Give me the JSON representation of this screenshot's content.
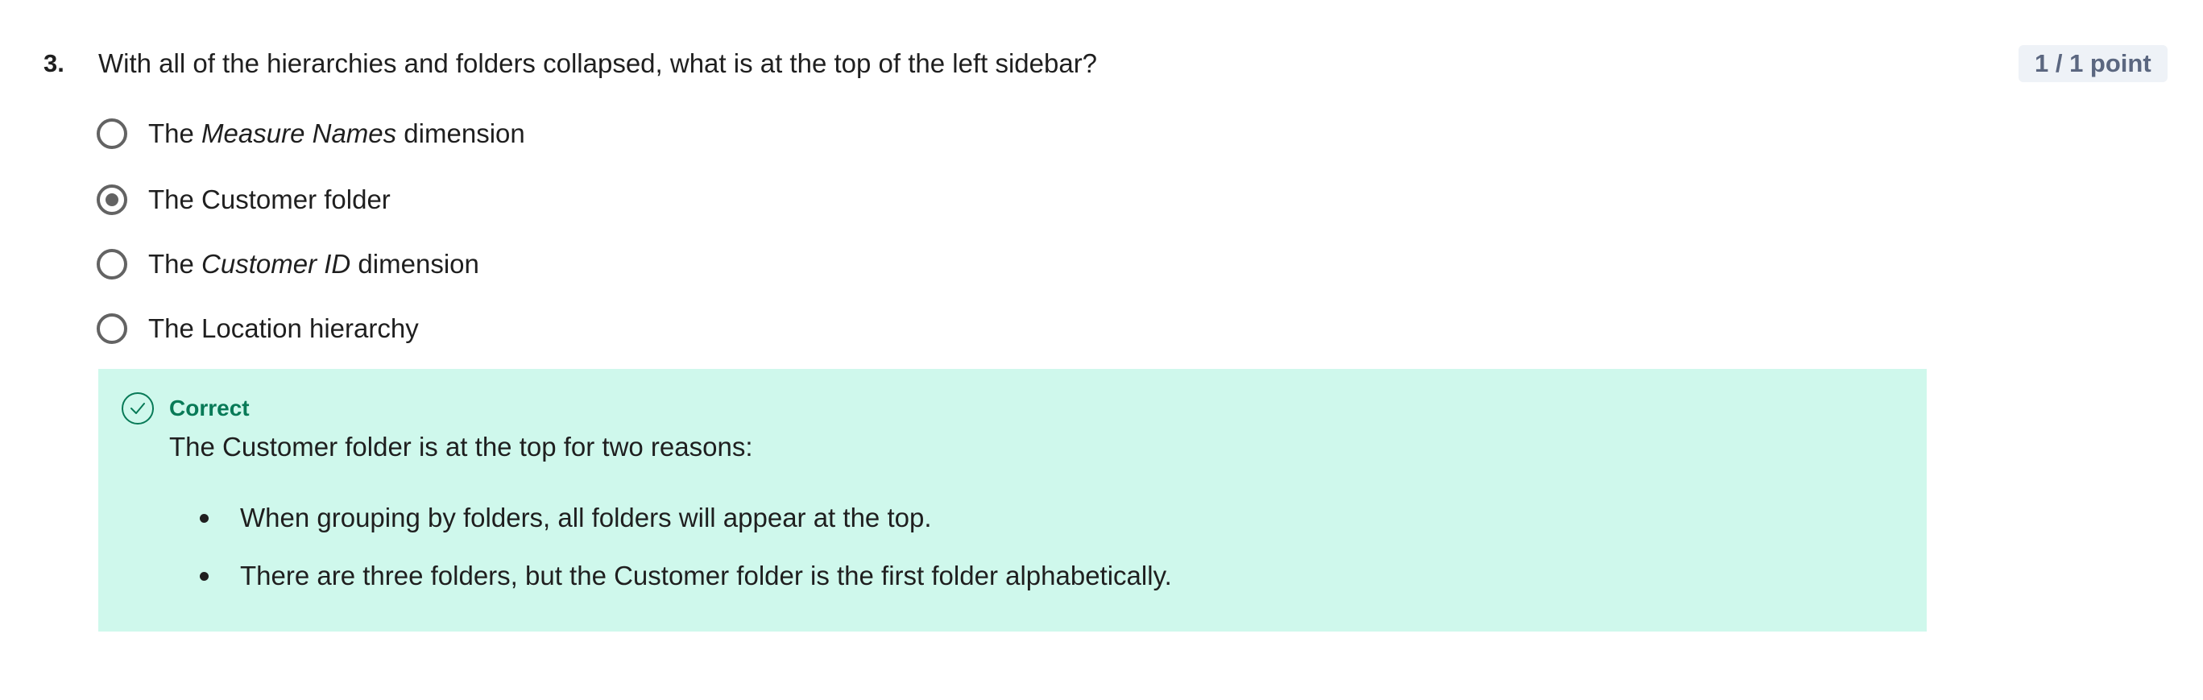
{
  "question": {
    "number": "3.",
    "text": "With all of the hierarchies and folders collapsed, what is at the top of the left sidebar?",
    "score": "1 / 1 point"
  },
  "options": [
    {
      "prefix": "The ",
      "emphasis": "Measure Names",
      "suffix": " dimension",
      "selected": false
    },
    {
      "prefix": "The Customer folder",
      "emphasis": "",
      "suffix": "",
      "selected": true
    },
    {
      "prefix": "The ",
      "emphasis": "Customer ID",
      "suffix": " dimension",
      "selected": false
    },
    {
      "prefix": "The Location hierarchy",
      "emphasis": "",
      "suffix": "",
      "selected": false
    }
  ],
  "feedback": {
    "status": "Correct",
    "icon": "check-circle-icon",
    "text": "The Customer folder is at the top for two reasons:",
    "bullets": [
      "When grouping by folders, all folders will appear at the top.",
      "There are three folders, but the Customer folder is the first folder alphabetically."
    ]
  },
  "colors": {
    "feedback_background": "#cff8ec",
    "feedback_title": "#087a57",
    "radio": "#636363",
    "score_background": "#eef2f7",
    "score_text": "#5b6780"
  }
}
